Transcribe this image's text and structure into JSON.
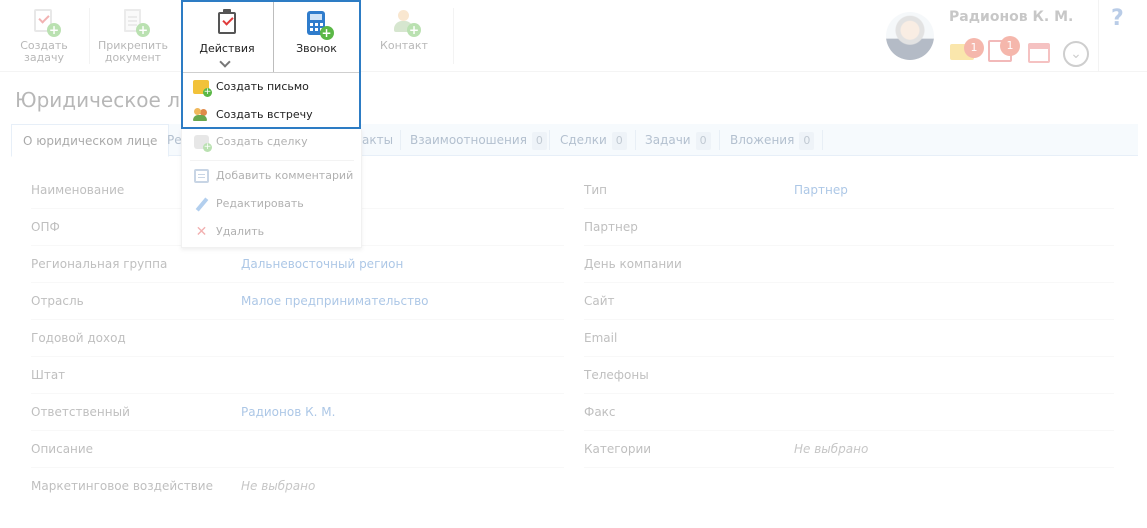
{
  "toolbar": {
    "create_task": "Создать\nзадачу",
    "attach_document": "Прикрепить\nдокумент",
    "actions": "Действия",
    "call": "Звонок",
    "contact": "Контакт"
  },
  "user": {
    "name": "Радионов К. М.",
    "mail_count": "1",
    "tasks_count": "1",
    "help": "?"
  },
  "page_title": "Юридическое лицо",
  "tabs": [
    {
      "label": "О юридическом лице",
      "count": ""
    },
    {
      "label": "Ре",
      "count": ""
    },
    {
      "label": "акты",
      "count": ""
    },
    {
      "label": "Взаимоотношения",
      "count": "0"
    },
    {
      "label": "Сделки",
      "count": "0"
    },
    {
      "label": "Задачи",
      "count": "0"
    },
    {
      "label": "Вложения",
      "count": "0"
    }
  ],
  "dropdown": {
    "create_letter": "Создать письмо",
    "create_meeting": "Создать встречу",
    "create_deal": "Создать сделку",
    "add_comment": "Добавить комментарий",
    "edit": "Редактировать",
    "delete": "Удалить"
  },
  "left_fields": [
    {
      "label": "Наименование",
      "value": ""
    },
    {
      "label": "ОПФ",
      "value": ""
    },
    {
      "label": "Региональная группа",
      "value": "Дальневосточный регион"
    },
    {
      "label": "Отрасль",
      "value": "Малое предпринимательство"
    },
    {
      "label": "Годовой доход",
      "value": ""
    },
    {
      "label": "Штат",
      "value": ""
    },
    {
      "label": "Ответственный",
      "value": "Радионов К. М."
    },
    {
      "label": "Описание",
      "value": ""
    },
    {
      "label": "Маркетинговое воздействие",
      "value": "Не выбрано"
    }
  ],
  "right_fields": [
    {
      "label": "Тип",
      "value": "Партнер"
    },
    {
      "label": "Партнер",
      "value": ""
    },
    {
      "label": "День компании",
      "value": ""
    },
    {
      "label": "Сайт",
      "value": ""
    },
    {
      "label": "Email",
      "value": ""
    },
    {
      "label": "Телефоны",
      "value": ""
    },
    {
      "label": "Факс",
      "value": ""
    },
    {
      "label": "Категории",
      "value": "Не выбрано"
    }
  ],
  "colors": {
    "accent": "#2d7cc4",
    "link": "#3b79c4",
    "badge": "#e8533a",
    "plus": "#5bb847"
  }
}
